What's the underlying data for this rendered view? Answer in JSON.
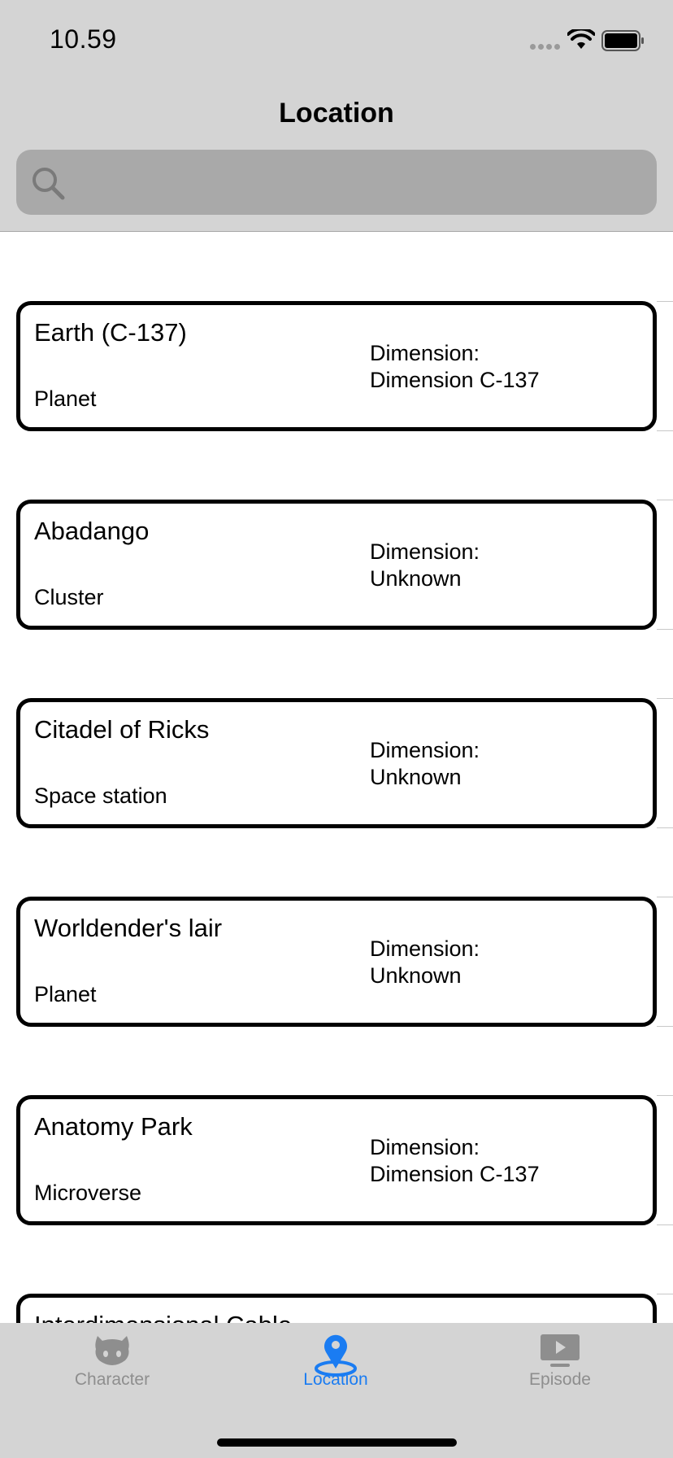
{
  "status_bar": {
    "time": "10.59"
  },
  "nav": {
    "title": "Location"
  },
  "search": {
    "placeholder": ""
  },
  "locations": [
    {
      "name": "Earth (C-137)",
      "type": "Planet",
      "dimension_label": "Dimension:",
      "dimension": "Dimension C-137"
    },
    {
      "name": "Abadango",
      "type": "Cluster",
      "dimension_label": "Dimension:",
      "dimension": "Unknown"
    },
    {
      "name": "Citadel of Ricks",
      "type": "Space station",
      "dimension_label": "Dimension:",
      "dimension": "Unknown"
    },
    {
      "name": "Worldender's lair",
      "type": "Planet",
      "dimension_label": "Dimension:",
      "dimension": "Unknown"
    },
    {
      "name": "Anatomy Park",
      "type": "Microverse",
      "dimension_label": "Dimension:",
      "dimension": "Dimension C-137"
    },
    {
      "name": "Interdimensional Cable",
      "type": "",
      "dimension_label": "",
      "dimension": ""
    }
  ],
  "tabbar": {
    "tabs": [
      {
        "label": "Character",
        "icon": "github-octocat-icon"
      },
      {
        "label": "Location",
        "icon": "location-pin-icon"
      },
      {
        "label": "Episode",
        "icon": "play-tv-icon"
      }
    ],
    "active_index": 1
  },
  "colors": {
    "accent": "#1a7cf2",
    "bar_background": "#d4d4d4",
    "search_background": "#a9a9a9",
    "inactive": "#8e8e8e"
  }
}
